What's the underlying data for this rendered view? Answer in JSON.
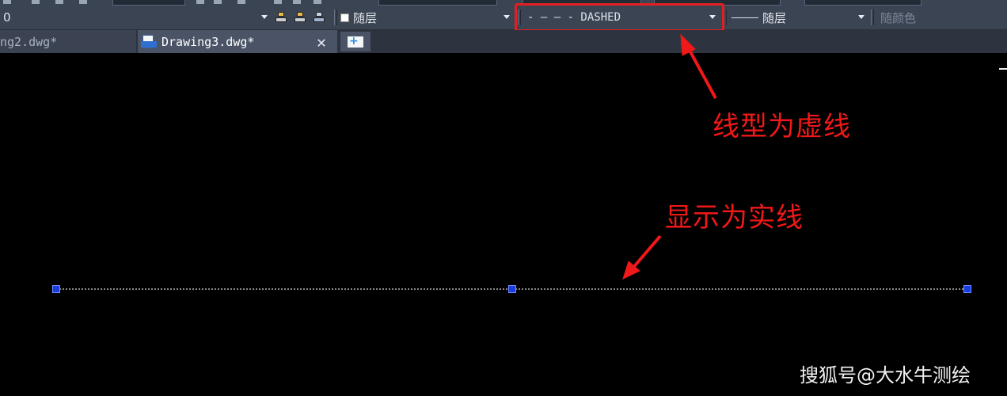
{
  "toolbar": {
    "layer_value": "0",
    "color_value": "随层",
    "linetype_value": "- — — - DASHED",
    "lineweight_value": "随层",
    "plotstyle_value": "随颜色"
  },
  "tabs": [
    {
      "label": "ng2.dwg*",
      "active": false
    },
    {
      "label": "Drawing3.dwg*",
      "active": true
    }
  ],
  "annotations": {
    "linetype_note": "线型为虚线",
    "display_note": "显示为实线"
  },
  "watermark": "搜狐号@大水牛测绘",
  "colors": {
    "annotation_red": "#f01818",
    "grip_blue": "#1a3de0",
    "toolbar_bg": "#3b4453",
    "canvas_bg": "#000000"
  }
}
